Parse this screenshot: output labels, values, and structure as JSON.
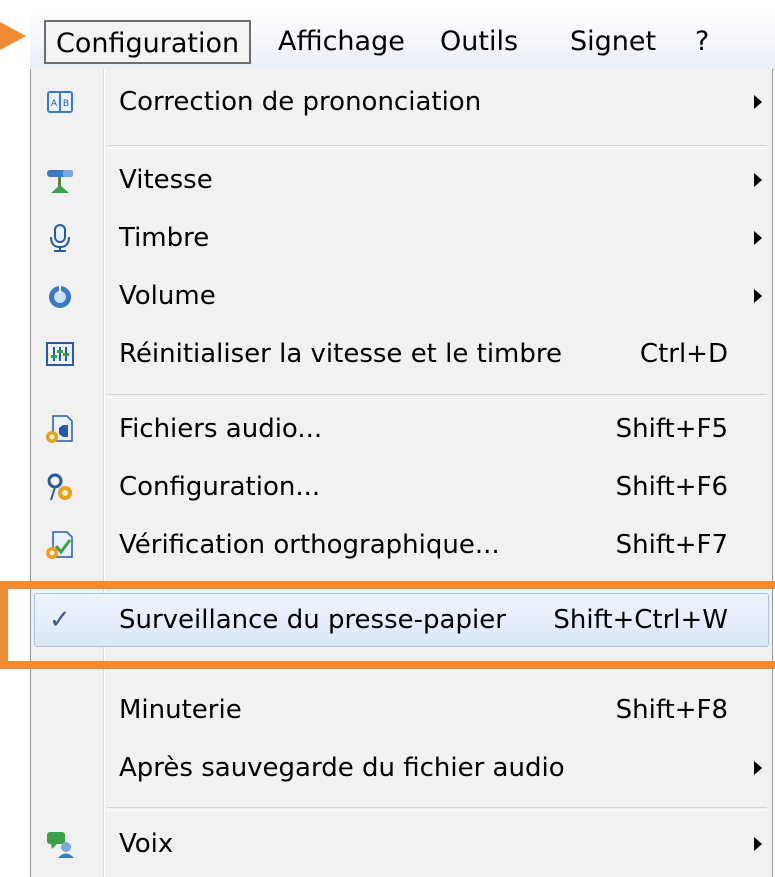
{
  "menubar": {
    "items": [
      "Configuration",
      "Affichage",
      "Outils",
      "Signet",
      "?"
    ]
  },
  "menu": {
    "items": [
      {
        "label": "Correction de prononciation",
        "icon": "ab-book-icon",
        "submenu": true
      },
      {
        "label": "Vitesse",
        "icon": "speed-icon",
        "submenu": true
      },
      {
        "label": "Timbre",
        "icon": "microphone-icon",
        "submenu": true
      },
      {
        "label": "Volume",
        "icon": "volume-icon",
        "submenu": true
      },
      {
        "label": "Réinitialiser la vitesse et le timbre",
        "shortcut": "Ctrl+D",
        "icon": "equalizer-icon"
      },
      {
        "label": "Fichiers audio...",
        "shortcut": "Shift+F5",
        "icon": "audio-file-icon"
      },
      {
        "label": "Configuration...",
        "shortcut": "Shift+F6",
        "icon": "settings-gear-icon"
      },
      {
        "label": "Vérification orthographique...",
        "shortcut": "Shift+F7",
        "icon": "spell-check-icon"
      },
      {
        "label": "Surveillance du presse-papier",
        "shortcut": "Shift+Ctrl+W",
        "checked": true,
        "highlighted": true
      },
      {
        "label": "Minuterie",
        "shortcut": "Shift+F8"
      },
      {
        "label": "Après sauvegarde du fichier audio",
        "submenu": true
      },
      {
        "label": "Voix",
        "icon": "voice-chat-icon",
        "submenu": true
      }
    ]
  },
  "colors": {
    "callout": "#ef8b34",
    "highlight_border": "#a8c4e6",
    "menu_bg": "#f1f1f1"
  }
}
